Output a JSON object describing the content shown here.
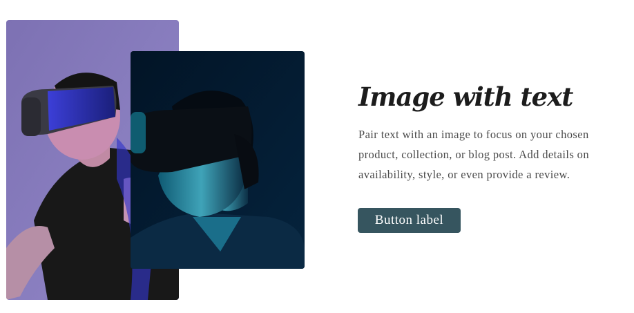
{
  "images": {
    "back_alt": "Person wearing VR headset in purple light",
    "front_alt": "Person wearing VR headset in blue light"
  },
  "section": {
    "heading": "Image with text",
    "body": "Pair text with an image to focus on your chosen product, collection, or blog post. Add details on availability, style, or even provide a review.",
    "button_label": "Button label"
  },
  "colors": {
    "button_bg": "#36555f",
    "heading": "#1c1c1c",
    "body": "#4a4a4a"
  }
}
